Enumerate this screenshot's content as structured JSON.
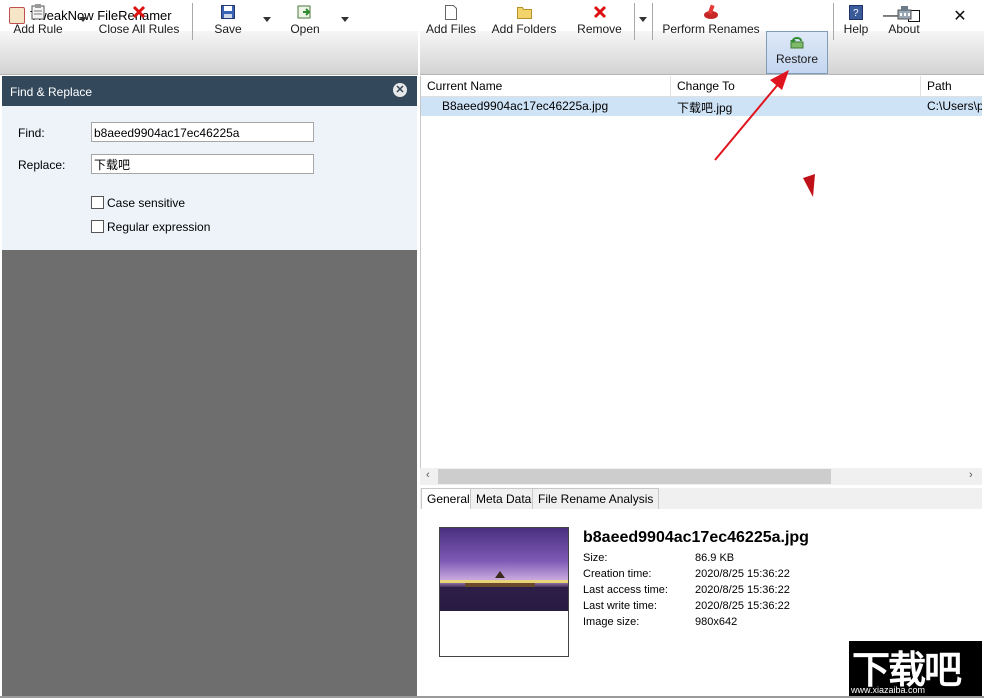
{
  "window": {
    "title": "TweakNow FileRenamer",
    "minimize_glyph": "—",
    "maximize_glyph": "☐",
    "close_glyph": "✕"
  },
  "toolbar_left": {
    "add_rule": "Add Rule",
    "close_all_rules": "Close All Rules",
    "save": "Save",
    "open": "Open"
  },
  "toolbar_right": {
    "add_files": "Add Files",
    "add_folders": "Add Folders",
    "remove": "Remove",
    "perform_renames": "Perform Renames",
    "restore": "Restore",
    "help": "Help",
    "about": "About"
  },
  "rule_panel": {
    "title": "Find & Replace",
    "close_glyph": "✕",
    "find_label": "Find:",
    "find_value": "b8aeed9904ac17ec46225a",
    "replace_label": "Replace:",
    "replace_value": "下载吧",
    "case_sensitive_label": "Case sensitive",
    "case_sensitive_checked": false,
    "regex_label": "Regular expression",
    "regex_checked": false
  },
  "file_list": {
    "columns": [
      "Current Name",
      "Change To",
      "Path"
    ],
    "rows": [
      {
        "current_name": "B8aeed9904ac17ec46225a.jpg",
        "change_to": "下载吧.jpg",
        "path": "C:\\Users\\pc"
      }
    ],
    "scroll_left": "‹",
    "scroll_right": "›"
  },
  "detail_tabs": [
    "General",
    "Meta Data",
    "File Rename Analysis"
  ],
  "details": {
    "file_name": "b8aeed9904ac17ec46225a.jpg",
    "fields": [
      {
        "label": "Size:",
        "value": "86.9 KB"
      },
      {
        "label": "Creation time:",
        "value": "2020/8/25 15:36:22"
      },
      {
        "label": "Last access time:",
        "value": "2020/8/25 15:36:22"
      },
      {
        "label": "Last write time:",
        "value": "2020/8/25 15:36:22"
      },
      {
        "label": "Image size:",
        "value": "980x642"
      }
    ]
  },
  "watermark": {
    "text": "下载吧",
    "url": "www.xiazaiba.com"
  },
  "colors": {
    "panel_header": "#33485b",
    "selected_row": "#cfe3f7",
    "annotation_arrow": "#e0141e",
    "active_button": "#c3d6f0"
  }
}
